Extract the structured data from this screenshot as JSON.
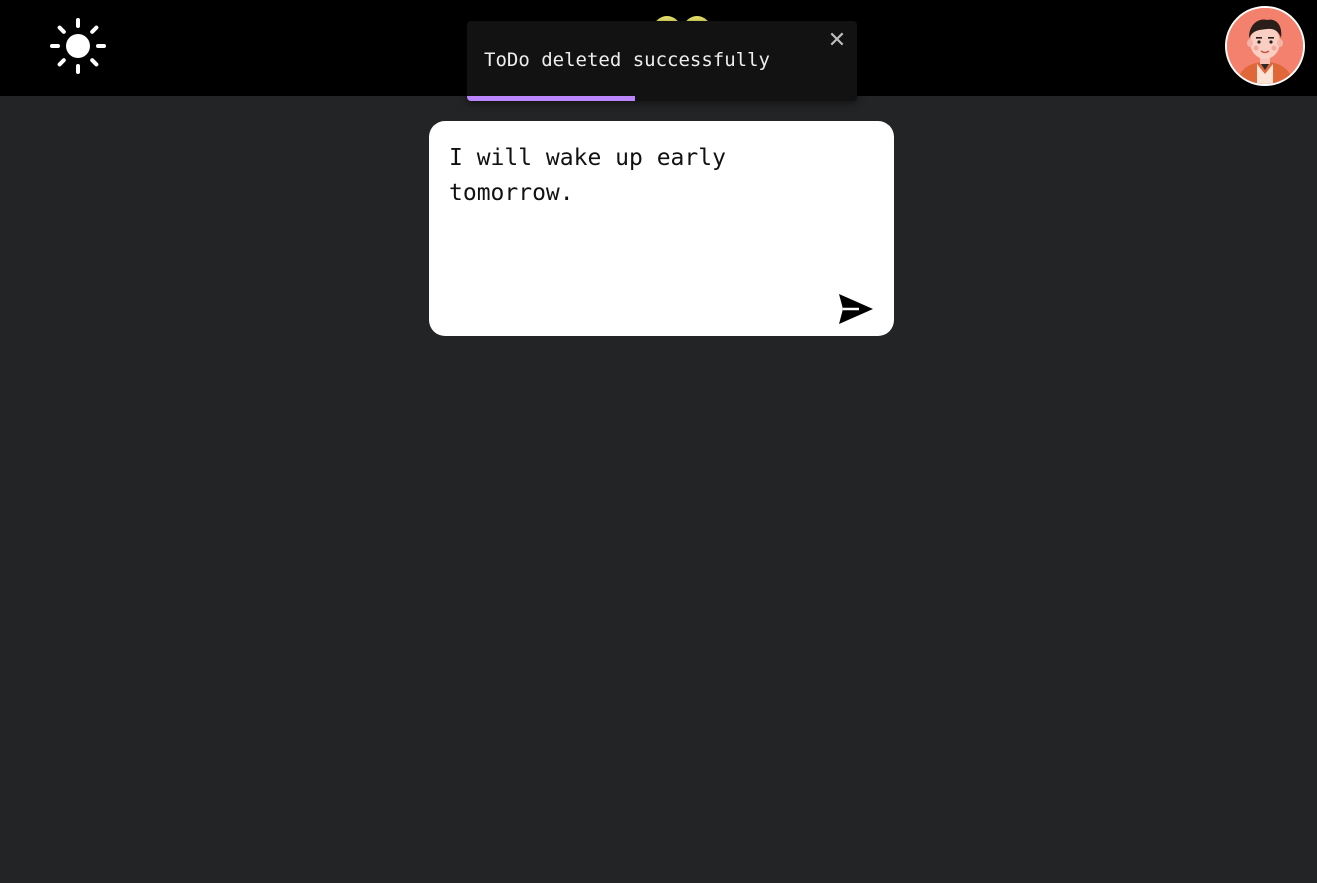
{
  "header": {
    "theme_icon": "sun-icon",
    "logo_icon": "logo-icon",
    "avatar_icon": "user-avatar-icon",
    "logo_color": "#e8e46a"
  },
  "toast": {
    "message": "ToDo deleted successfully",
    "close_label": "✕",
    "progress": 0.43,
    "progress_color": "#bb86fc"
  },
  "composer": {
    "value": "I will wake up early tomorrow.",
    "send_icon": "send-icon"
  }
}
